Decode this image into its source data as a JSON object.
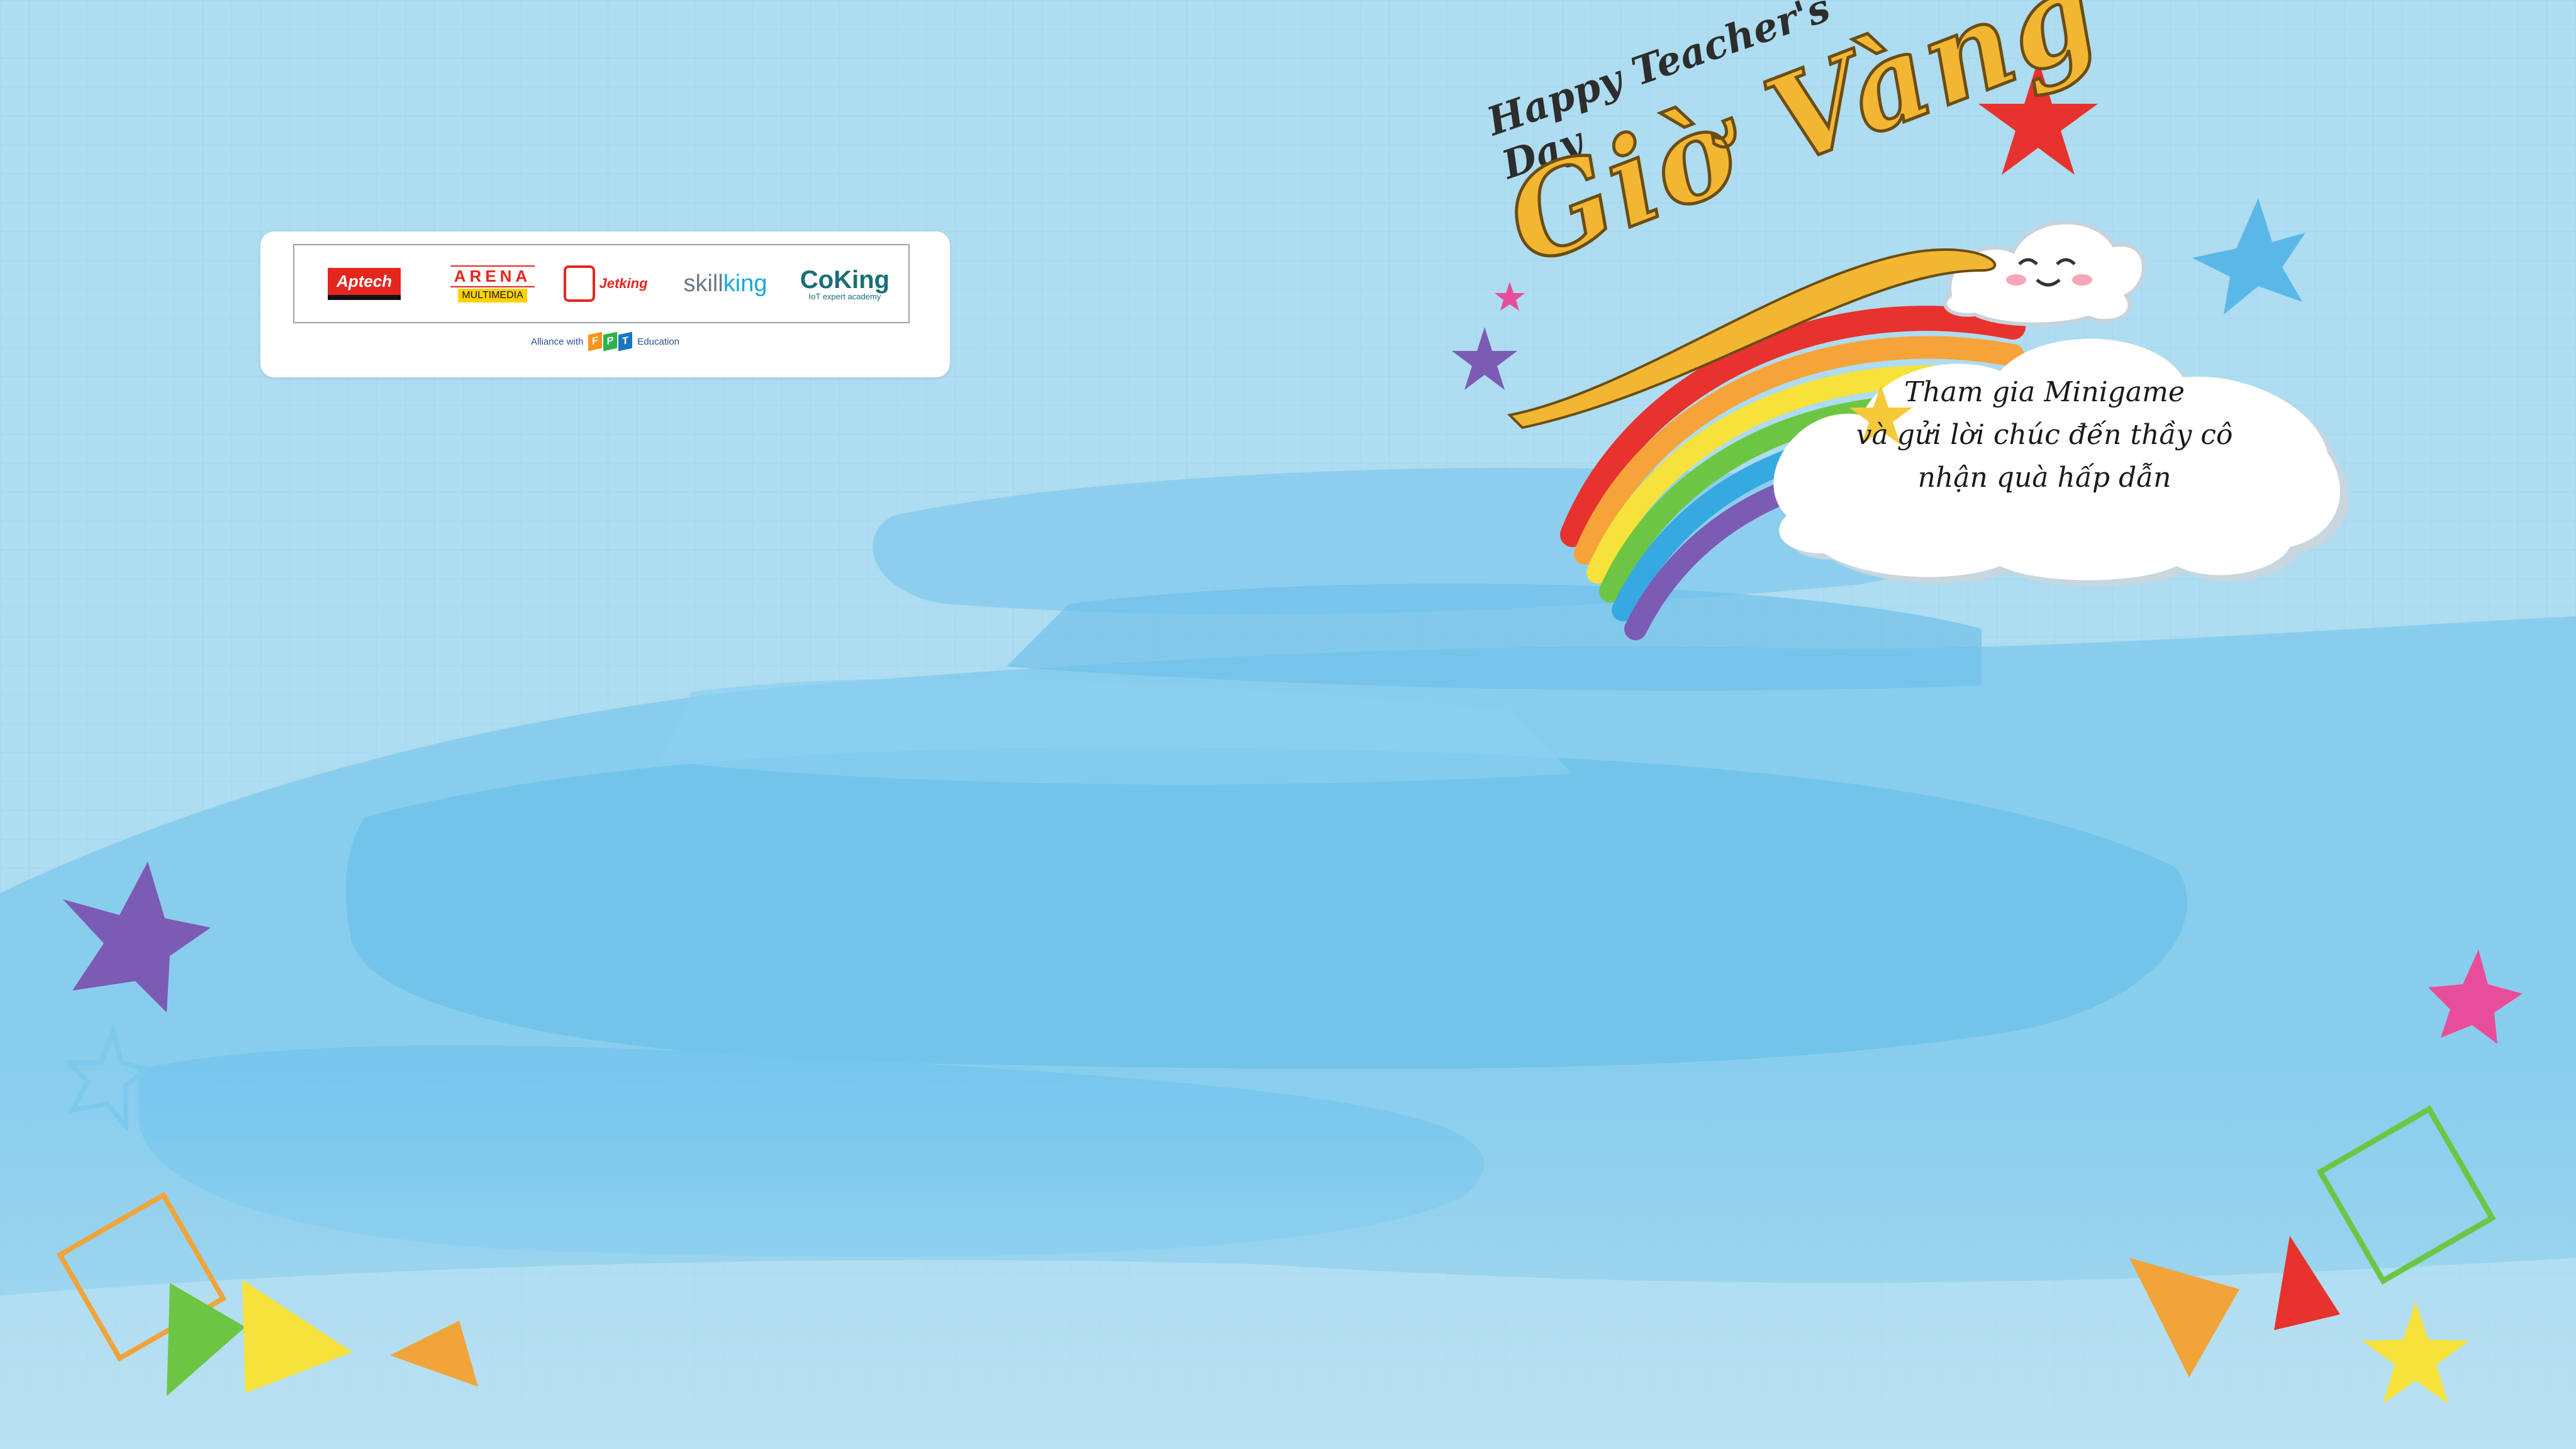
{
  "brands": {
    "aptech": {
      "name": "Aptech",
      "sub": "COMPUTER EDUCATION"
    },
    "arena": {
      "top": "ARENA",
      "bottom": "MULTIMEDIA"
    },
    "jetking": {
      "name": "Jetking"
    },
    "skillking": {
      "part1": "skill",
      "part2": "king"
    },
    "coking": {
      "name": "CoKing",
      "sub": "IoT expert academy"
    }
  },
  "alliance": {
    "prefix": "Alliance with",
    "letters": [
      "F",
      "P",
      "T"
    ],
    "suffix": "Education"
  },
  "headline": {
    "happy": "Happy Teacher's Day",
    "title": "Giờ Vàng"
  },
  "cloud_message": {
    "line1": "Tham gia Minigame",
    "line2": "và gửi lời chúc đến thầy cô",
    "line3": "nhận quà hấp dẫn"
  },
  "colors": {
    "background": "#aedcf0",
    "brush": "#6ec2ea",
    "title_gold": "#f2b632",
    "rainbow": [
      "#e7322d",
      "#f6a33a",
      "#f6e23a",
      "#6cc644",
      "#36a9e1",
      "#7c5bb5"
    ],
    "fpt": [
      "#f7941d",
      "#2db34a",
      "#1c75bc"
    ]
  },
  "icons": [
    "star-icon",
    "triangle-icon",
    "square-outline-icon",
    "cloud-face-icon",
    "rainbow-icon"
  ]
}
